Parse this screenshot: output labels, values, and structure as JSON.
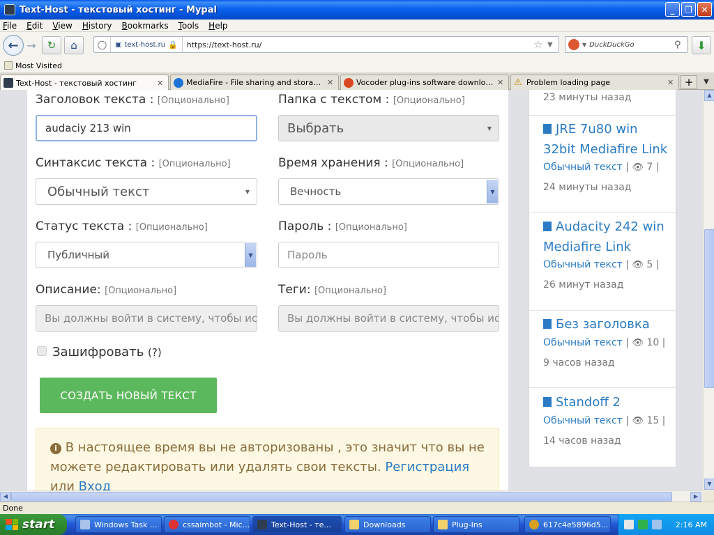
{
  "window": {
    "title": "Text-Host - текстовый хостинг - Mypal",
    "minimize": "_",
    "maximize": "❐",
    "close": "✕"
  },
  "menu": [
    "File",
    "Edit",
    "View",
    "History",
    "Bookmarks",
    "Tools",
    "Help"
  ],
  "nav": {
    "site_label": "text-host.ru",
    "url": "https://text-host.ru/",
    "search_placeholder": "DuckDuckGo"
  },
  "bookmarks": {
    "most_visited": "Most Visited"
  },
  "tabs": [
    {
      "label": "Text-Host - текстовый хостинг",
      "active": true
    },
    {
      "label": "MediaFire - File sharing and storage ma...",
      "active": false
    },
    {
      "label": "Vocoder plug-ins software downloads f...",
      "active": false
    },
    {
      "label": "Problem loading page",
      "active": false
    }
  ],
  "form": {
    "optional": "[Опционально]",
    "title_label": "Заголовок текста :",
    "title_value": "audaciy 213 win",
    "folder_label": "Папка с текстом :",
    "folder_value": "Выбрать",
    "syntax_label": "Синтаксис текста :",
    "syntax_value": "Обычный текст",
    "expire_label": "Время хранения :",
    "expire_value": "Вечность",
    "status_label": "Статус текста :",
    "status_value": "Публичный",
    "password_label": "Пароль :",
    "password_placeholder": "Пароль",
    "desc_label": "Описание:",
    "desc_placeholder": "Вы должны войти в систему, чтобы исп",
    "tags_label": "Теги:",
    "tags_placeholder": "Вы должны войти в систему, чтобы исп",
    "encrypt_label": "Зашифровать",
    "encrypt_help": "(?)",
    "submit_label": "СОЗДАТЬ НОВЫЙ ТЕКСТ"
  },
  "notice": {
    "text": "В настоящее время вы не авторизованы , это значит что вы не можете редактировать или удалять свои тексты.",
    "register": "Регистрация",
    "or": "или",
    "login": "Вход"
  },
  "sidebar": {
    "top_time": "23 минуты назад",
    "items": [
      {
        "title": "JRE 7u80 win 32bit Mediafire Link",
        "type": "Обычный текст",
        "views": "7",
        "time": "24 минуты назад"
      },
      {
        "title": "Audacity 242 win Mediafire Link",
        "type": "Обычный текст",
        "views": "5",
        "time": "26 минут назад"
      },
      {
        "title": "Без заголовка",
        "type": "Обычный текст",
        "views": "10",
        "time": "9 часов назад"
      },
      {
        "title": "Standoff 2",
        "type": "Обычный текст",
        "views": "15",
        "time": "14 часов назад"
      }
    ]
  },
  "status": "Done",
  "taskbar": {
    "start": "start",
    "tasks": [
      {
        "label": "Windows Task ..."
      },
      {
        "label": "cssaimbot - Mic..."
      },
      {
        "label": "Text-Host - те..."
      },
      {
        "label": "Downloads"
      },
      {
        "label": "Plug-Ins"
      },
      {
        "label": "617c4e5896d5..."
      }
    ],
    "clock": "2:16 AM"
  },
  "colors": {
    "accent_link": "#2a7bc4",
    "submit_green": "#5cb85c",
    "notice_bg": "#fcf8e3",
    "notice_text": "#8a6d3b"
  }
}
